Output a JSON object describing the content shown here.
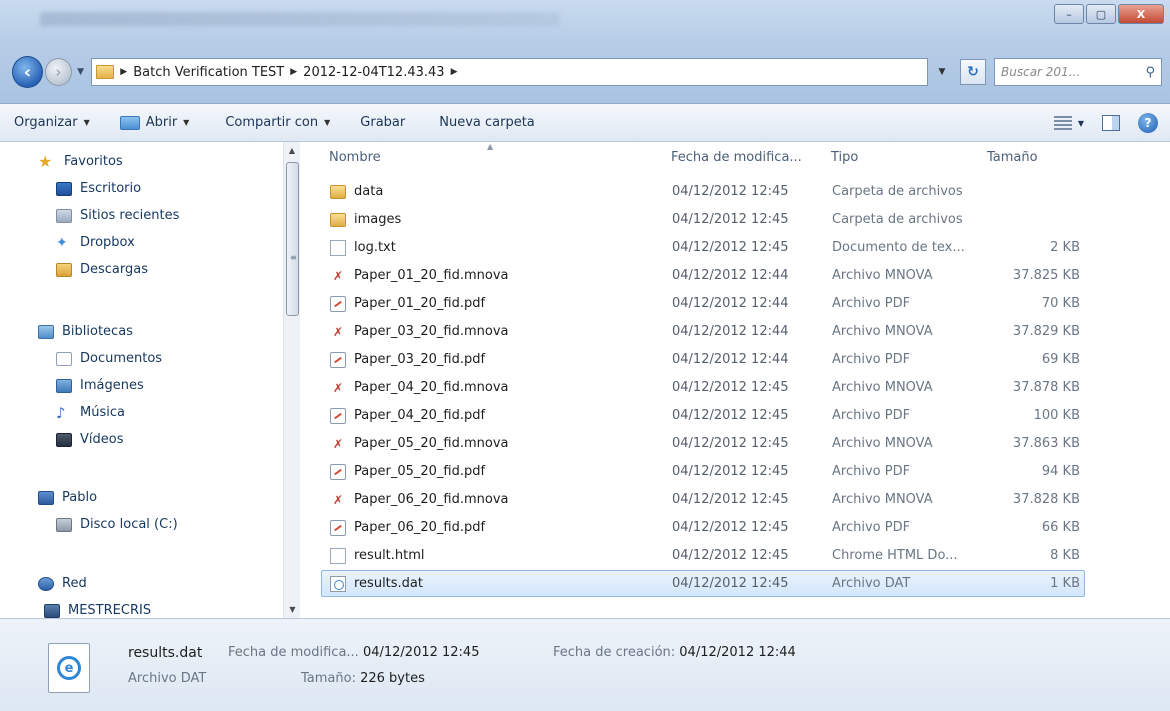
{
  "window": {
    "minimize": "–",
    "maximize": "▢",
    "close": "X"
  },
  "address": {
    "path": [
      "Batch Verification TEST",
      "2012-12-04T12.43.43"
    ],
    "search_placeholder": "Buscar 201..."
  },
  "toolbar": {
    "organize": "Organizar",
    "open": "Abrir",
    "share": "Compartir con",
    "burn": "Grabar",
    "new_folder": "Nueva carpeta"
  },
  "nav": {
    "favorites": {
      "label": "Favoritos",
      "items": [
        "Escritorio",
        "Sitios recientes",
        "Dropbox",
        "Descargas"
      ]
    },
    "libraries": {
      "label": "Bibliotecas",
      "items": [
        "Documentos",
        "Imágenes",
        "Música",
        "Vídeos"
      ]
    },
    "user": {
      "label": "Pablo",
      "items": [
        "Disco local (C:)"
      ]
    },
    "network": {
      "label": "Red",
      "items": [
        "MESTRECRIS"
      ]
    }
  },
  "columns": {
    "name": "Nombre",
    "date": "Fecha de modifica...",
    "type": "Tipo",
    "size": "Tamaño"
  },
  "files": [
    {
      "name": "data",
      "date": "04/12/2012 12:45",
      "type": "Carpeta de archivos",
      "size": "",
      "icon": "folder"
    },
    {
      "name": "images",
      "date": "04/12/2012 12:45",
      "type": "Carpeta de archivos",
      "size": "",
      "icon": "folder"
    },
    {
      "name": "log.txt",
      "date": "04/12/2012 12:45",
      "type": "Documento de tex...",
      "size": "2 KB",
      "icon": "text"
    },
    {
      "name": "Paper_01_20_fid.mnova",
      "date": "04/12/2012 12:44",
      "type": "Archivo MNOVA",
      "size": "37.825 KB",
      "icon": "mnova"
    },
    {
      "name": "Paper_01_20_fid.pdf",
      "date": "04/12/2012 12:44",
      "type": "Archivo PDF",
      "size": "70 KB",
      "icon": "pdf"
    },
    {
      "name": "Paper_03_20_fid.mnova",
      "date": "04/12/2012 12:44",
      "type": "Archivo MNOVA",
      "size": "37.829 KB",
      "icon": "mnova"
    },
    {
      "name": "Paper_03_20_fid.pdf",
      "date": "04/12/2012 12:44",
      "type": "Archivo PDF",
      "size": "69 KB",
      "icon": "pdf"
    },
    {
      "name": "Paper_04_20_fid.mnova",
      "date": "04/12/2012 12:45",
      "type": "Archivo MNOVA",
      "size": "37.878 KB",
      "icon": "mnova"
    },
    {
      "name": "Paper_04_20_fid.pdf",
      "date": "04/12/2012 12:45",
      "type": "Archivo PDF",
      "size": "100 KB",
      "icon": "pdf"
    },
    {
      "name": "Paper_05_20_fid.mnova",
      "date": "04/12/2012 12:45",
      "type": "Archivo MNOVA",
      "size": "37.863 KB",
      "icon": "mnova"
    },
    {
      "name": "Paper_05_20_fid.pdf",
      "date": "04/12/2012 12:45",
      "type": "Archivo PDF",
      "size": "94 KB",
      "icon": "pdf"
    },
    {
      "name": "Paper_06_20_fid.mnova",
      "date": "04/12/2012 12:45",
      "type": "Archivo MNOVA",
      "size": "37.828 KB",
      "icon": "mnova"
    },
    {
      "name": "Paper_06_20_fid.pdf",
      "date": "04/12/2012 12:45",
      "type": "Archivo PDF",
      "size": "66 KB",
      "icon": "pdf"
    },
    {
      "name": "result.html",
      "date": "04/12/2012 12:45",
      "type": "Chrome HTML Do...",
      "size": "8 KB",
      "icon": "html"
    },
    {
      "name": "results.dat",
      "date": "04/12/2012 12:45",
      "type": "Archivo DAT",
      "size": "1 KB",
      "icon": "dat",
      "selected": true
    }
  ],
  "details": {
    "name": "results.dat",
    "type": "Archivo DAT",
    "modified_label": "Fecha de modifica...",
    "modified_value": "04/12/2012 12:45",
    "size_label": "Tamaño:",
    "size_value": "226 bytes",
    "created_label": "Fecha de creación:",
    "created_value": "04/12/2012 12:44"
  },
  "colors": {
    "selection_border": "#8fb8e6",
    "link_text": "#16375f"
  }
}
